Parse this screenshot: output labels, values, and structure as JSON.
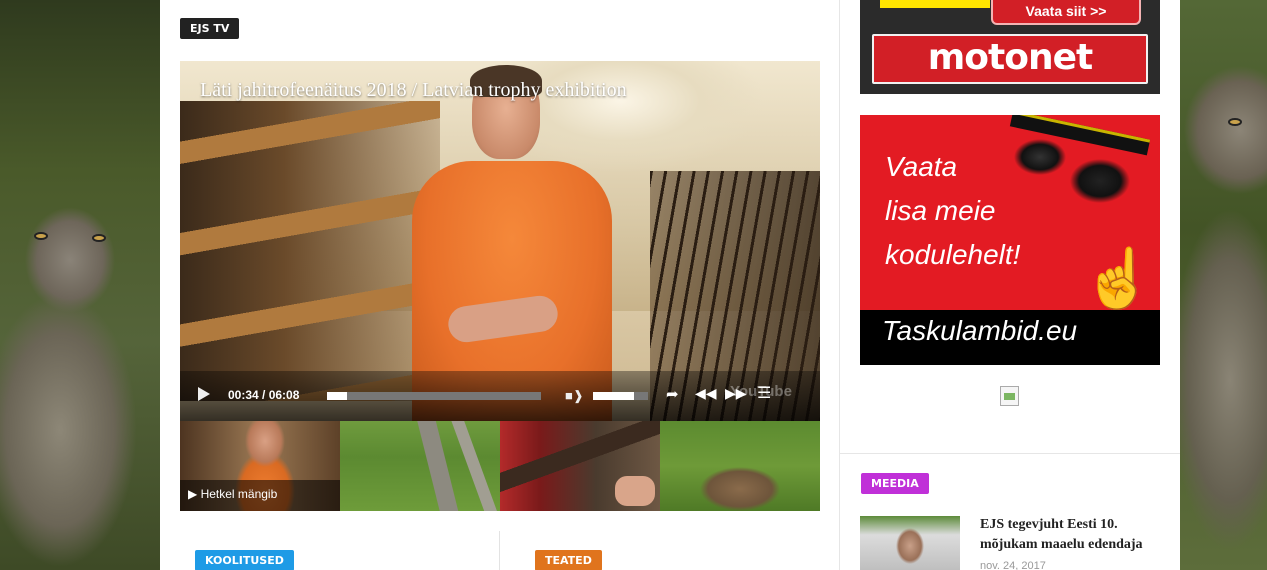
{
  "main": {
    "section_tag": "EJS TV",
    "video": {
      "title": "Läti jahitrofeenäitus 2018 / Latvian trophy exhibition",
      "time": "00:34 / 06:08",
      "progress_fraction": 0.093,
      "volume_fraction": 0.75,
      "watermark": "YouTube"
    },
    "playlist": {
      "now_playing_label": "▶ Hetkel mängib"
    },
    "bottom_tags": [
      "KOOLITUSED",
      "TEATED"
    ]
  },
  "sidebar": {
    "ad_motonet": {
      "button": "Vaata siit >>",
      "brand": "motonet"
    },
    "ad_taskulambid": {
      "line1": "Vaata",
      "line2": "lisa meie",
      "line3": "kodulehelt!",
      "brand": "Taskulambid.eu"
    },
    "section_tag": "MEEDIA",
    "news": {
      "title": "EJS tegevjuht Eesti 10. mõjukam maaelu edendaja",
      "date": "nov. 24, 2017"
    }
  },
  "colors": {
    "tag_dark": "#222222",
    "tag_blue": "#1e9be6",
    "tag_orange": "#e0741d",
    "tag_purple": "#c030d8",
    "ad_red": "#d21f26"
  }
}
